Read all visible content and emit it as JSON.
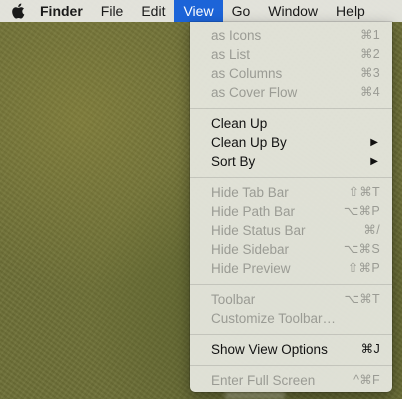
{
  "menubar": {
    "items": [
      {
        "label": "Finder"
      },
      {
        "label": "File"
      },
      {
        "label": "Edit"
      },
      {
        "label": "View"
      },
      {
        "label": "Go"
      },
      {
        "label": "Window"
      },
      {
        "label": "Help"
      }
    ],
    "active_item": "View",
    "active_color": "#1c64d8"
  },
  "view_menu": {
    "items": [
      {
        "label": "as Icons",
        "shortcut": "⌘1",
        "enabled": false
      },
      {
        "label": "as List",
        "shortcut": "⌘2",
        "enabled": false
      },
      {
        "label": "as Columns",
        "shortcut": "⌘3",
        "enabled": false
      },
      {
        "label": "as Cover Flow",
        "shortcut": "⌘4",
        "enabled": false
      },
      {
        "label": "Clean Up",
        "shortcut": "",
        "enabled": true
      },
      {
        "label": "Clean Up By",
        "shortcut": "▶",
        "enabled": true
      },
      {
        "label": "Sort By",
        "shortcut": "▶",
        "enabled": true
      },
      {
        "label": "Hide Tab Bar",
        "shortcut": "⇧⌘T",
        "enabled": false
      },
      {
        "label": "Hide Path Bar",
        "shortcut": "⌥⌘P",
        "enabled": false
      },
      {
        "label": "Hide Status Bar",
        "shortcut": "⌘/",
        "enabled": false
      },
      {
        "label": "Hide Sidebar",
        "shortcut": "⌥⌘S",
        "enabled": false
      },
      {
        "label": "Hide Preview",
        "shortcut": "⇧⌘P",
        "enabled": false
      },
      {
        "label": "Toolbar",
        "shortcut": "⌥⌘T",
        "enabled": false
      },
      {
        "label": "Customize Toolbar…",
        "shortcut": "",
        "enabled": false
      },
      {
        "label": "Show View Options",
        "shortcut": "⌘J",
        "enabled": true
      },
      {
        "label": "Enter Full Screen",
        "shortcut": "^⌘F",
        "enabled": false
      }
    ]
  },
  "icons": {
    "apple": "apple-logo-icon",
    "submenu": "submenu-arrow-icon"
  }
}
